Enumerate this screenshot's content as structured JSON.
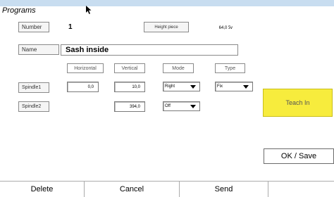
{
  "header": {
    "title": "Programs"
  },
  "program": {
    "number_label": "Number",
    "number_value": "1",
    "height_label": "Height piece",
    "height_value": "64,0 ㏜",
    "name_label": "Name",
    "name_value": "Sash inside"
  },
  "columns": {
    "horizontal": "Horizontal",
    "vertical": "Vertical",
    "mode": "Mode",
    "type": "Type"
  },
  "spindle1": {
    "label": "Spindle1",
    "horizontal": "0,0",
    "vertical": "10,0",
    "mode": "Right",
    "type": "Fix"
  },
  "spindle2": {
    "label": "Spindle2",
    "vertical": "394,0",
    "mode": "Off"
  },
  "buttons": {
    "teach_in": "Teach In",
    "ok_save": "OK / Save",
    "delete": "Delete",
    "cancel": "Cancel",
    "send": "Send"
  },
  "colors": {
    "topbar": "#c8ddf0",
    "teach_in": "#f7ec3d"
  },
  "icons": {
    "cursor": "mouse-pointer-icon",
    "dropdown": "chevron-down-icon"
  }
}
